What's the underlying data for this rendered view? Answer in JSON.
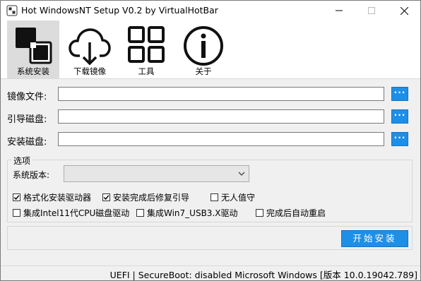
{
  "window": {
    "title": "Hot WindowsNT Setup V0.2 by VirtualHotBar"
  },
  "toolbar": {
    "items": [
      {
        "label": "系统安装",
        "icon": "install-blocks-icon",
        "active": true
      },
      {
        "label": "下载镜像",
        "icon": "cloud-download-icon",
        "active": false
      },
      {
        "label": "工具",
        "icon": "tools-grid-icon",
        "active": false
      },
      {
        "label": "关于",
        "icon": "info-icon",
        "active": false
      }
    ]
  },
  "form": {
    "image_file": {
      "label": "镜像文件:",
      "value": "",
      "browse_label": "···"
    },
    "boot_disk": {
      "label": "引导磁盘:",
      "value": "",
      "browse_label": "···"
    },
    "install_disk": {
      "label": "安装磁盘:",
      "value": "",
      "browse_label": "···"
    }
  },
  "options": {
    "title": "选项",
    "version_label": "系统版本:",
    "version_value": "",
    "checkboxes": [
      {
        "label": "格式化安装驱动器",
        "checked": true
      },
      {
        "label": "安装完成后修复引导",
        "checked": true
      },
      {
        "label": "无人值守",
        "checked": false
      },
      {
        "label": "集成Intel11代CPU磁盘驱动",
        "checked": false
      },
      {
        "label": "集成Win7_USB3.X驱动",
        "checked": false
      },
      {
        "label": "完成后自动重启",
        "checked": false
      }
    ]
  },
  "actions": {
    "start_label": "开始安装"
  },
  "status": {
    "text": "UEFI | SecureBoot: disabled  Microsoft Windows [版本 10.0.19042.789]"
  },
  "colors": {
    "accent": "#1e8fe6",
    "active_tab": "#dcdcdc",
    "window_bg": "#f0f0f0"
  }
}
